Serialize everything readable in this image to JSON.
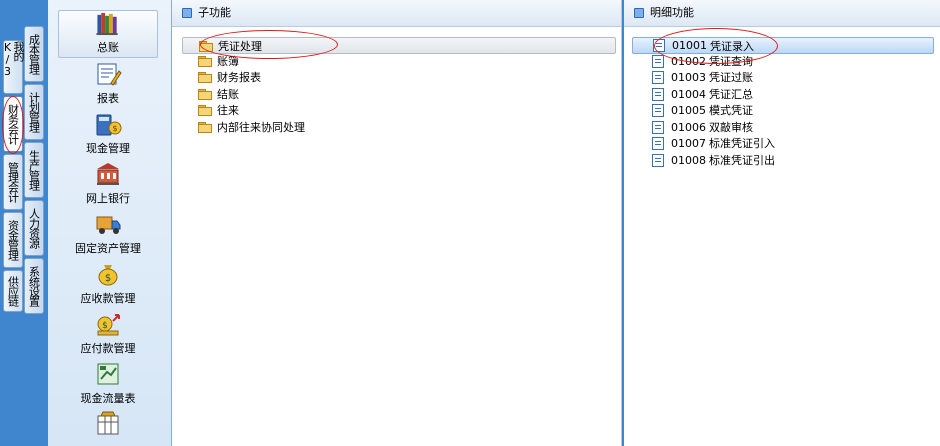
{
  "left_tabs": [
    {
      "label": "我的K/3"
    },
    {
      "label": "财务会计",
      "active": true
    },
    {
      "label": "管理会计"
    },
    {
      "label": "资金管理"
    },
    {
      "label": "供应链"
    },
    {
      "label": "成本管理"
    },
    {
      "label": "计划管理"
    },
    {
      "label": "生产管理"
    },
    {
      "label": "人力资源"
    },
    {
      "label": "系统设置"
    }
  ],
  "modules": [
    {
      "label": "总账",
      "icon": "books-icon",
      "selected": true
    },
    {
      "label": "报表",
      "icon": "report-edit-icon"
    },
    {
      "label": "现金管理",
      "icon": "cash-calculator-icon"
    },
    {
      "label": "网上银行",
      "icon": "bank-building-icon"
    },
    {
      "label": "固定资产管理",
      "icon": "truck-icon"
    },
    {
      "label": "应收款管理",
      "icon": "money-bag-icon"
    },
    {
      "label": "应付款管理",
      "icon": "money-payment-icon"
    },
    {
      "label": "现金流量表",
      "icon": "cash-flow-icon"
    },
    {
      "label": "",
      "icon": "toolbox-icon"
    }
  ],
  "sub_panel": {
    "title": "子功能",
    "items": [
      {
        "label": "凭证处理",
        "selected": true
      },
      {
        "label": "账簿"
      },
      {
        "label": "财务报表"
      },
      {
        "label": "结账"
      },
      {
        "label": "往来"
      },
      {
        "label": "内部往来协同处理"
      }
    ]
  },
  "detail_panel": {
    "title": "明细功能",
    "items": [
      {
        "code": "01001",
        "label": "凭证录入",
        "selected": true
      },
      {
        "code": "01002",
        "label": "凭证查询"
      },
      {
        "code": "01003",
        "label": "凭证过账"
      },
      {
        "code": "01004",
        "label": "凭证汇总"
      },
      {
        "code": "01005",
        "label": "模式凭证"
      },
      {
        "code": "01006",
        "label": "双敲审核"
      },
      {
        "code": "01007",
        "label": "标准凭证引入"
      },
      {
        "code": "01008",
        "label": "标准凭证引出"
      }
    ]
  },
  "colors": {
    "accent": "#3f86cf",
    "annotation": "#e01818"
  }
}
